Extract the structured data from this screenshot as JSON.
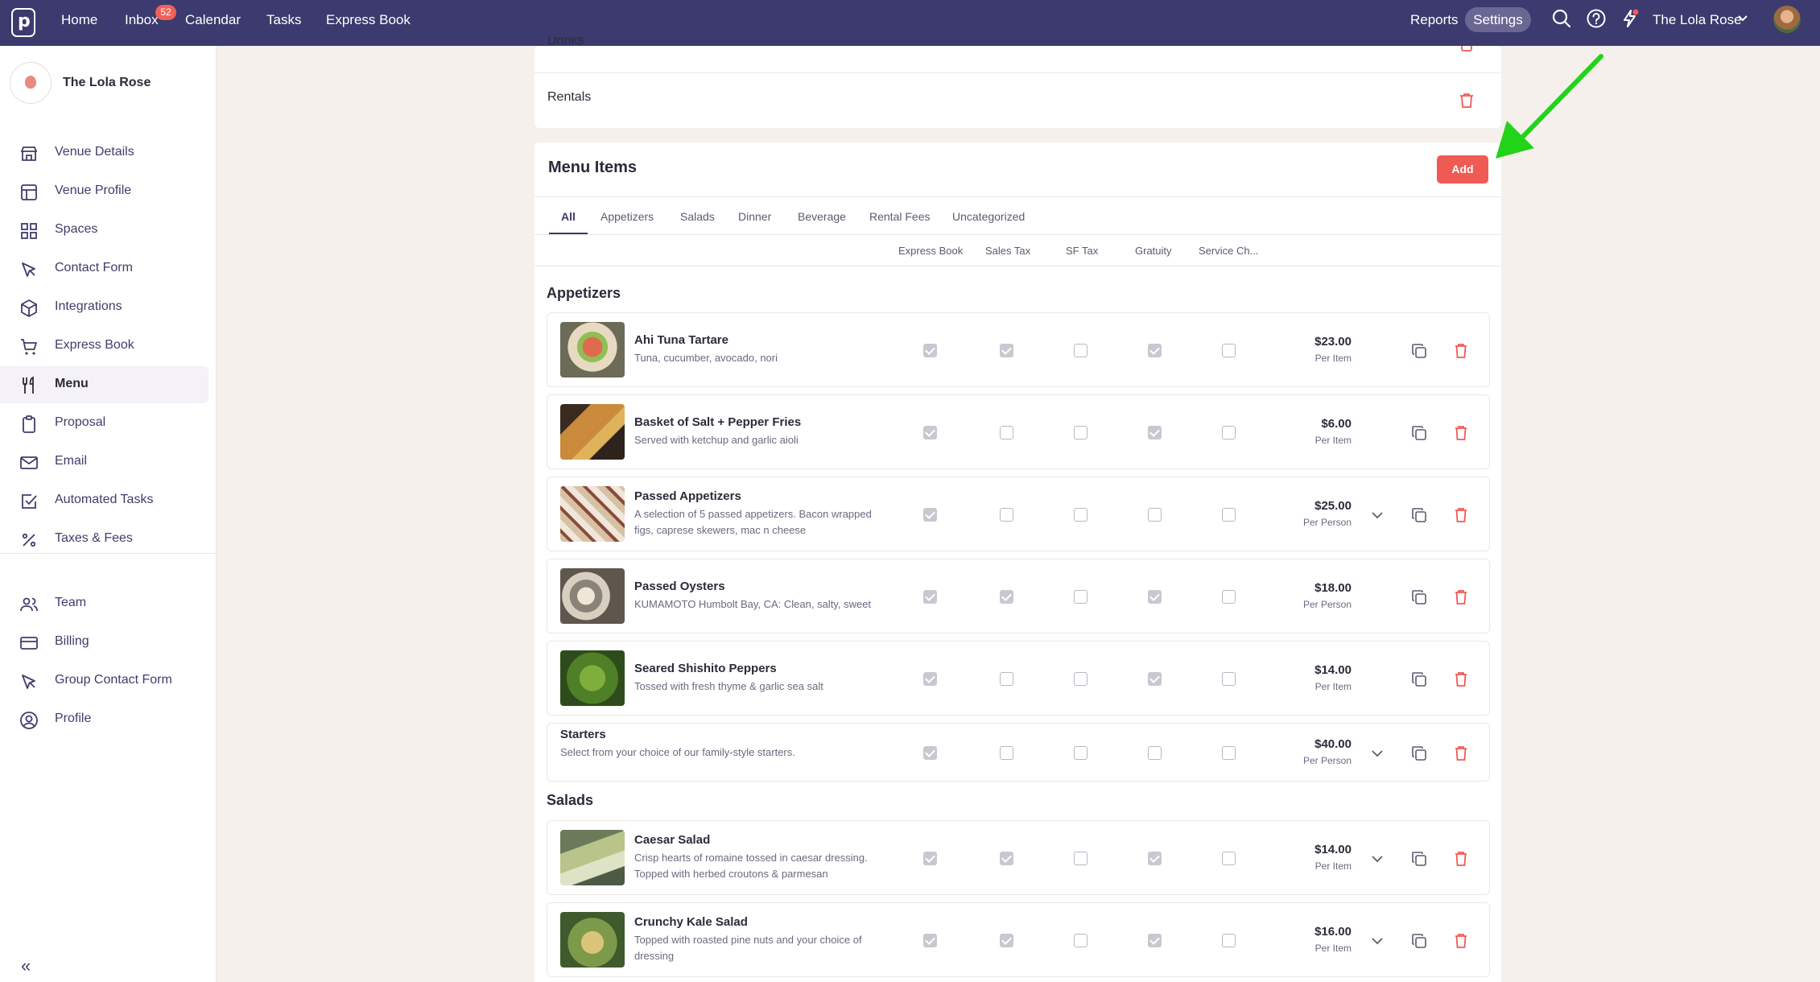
{
  "topbar": {
    "logo_letter": "p",
    "nav": [
      {
        "label": "Home"
      },
      {
        "label": "Inbox"
      },
      {
        "label": "Calendar"
      },
      {
        "label": "Tasks"
      },
      {
        "label": "Express Book"
      }
    ],
    "inbox_count": "52",
    "reports_label": "Reports",
    "settings_label": "Settings",
    "account_name": "The Lola Rose"
  },
  "sidebar": {
    "venue_name": "The Lola Rose",
    "items": [
      {
        "label": "Venue Details",
        "icon": "storefront-icon"
      },
      {
        "label": "Venue Profile",
        "icon": "layout-icon"
      },
      {
        "label": "Spaces",
        "icon": "grid-icon"
      },
      {
        "label": "Contact Form",
        "icon": "cursor-icon"
      },
      {
        "label": "Integrations",
        "icon": "cube-icon"
      },
      {
        "label": "Express Book",
        "icon": "cart-icon"
      },
      {
        "label": "Menu",
        "icon": "fork-knife-icon"
      },
      {
        "label": "Proposal",
        "icon": "clipboard-icon"
      },
      {
        "label": "Email",
        "icon": "mail-icon"
      },
      {
        "label": "Automated Tasks",
        "icon": "checkbox-icon"
      },
      {
        "label": "Taxes & Fees",
        "icon": "percent-icon"
      }
    ],
    "bottom_items": [
      {
        "label": "Team",
        "icon": "people-icon"
      },
      {
        "label": "Billing",
        "icon": "card-icon"
      },
      {
        "label": "Group Contact Form",
        "icon": "cursor-icon"
      },
      {
        "label": "Profile",
        "icon": "user-circle-icon"
      }
    ],
    "active": "Menu"
  },
  "categories_list": {
    "partial_row": "Drinks",
    "last_row": "Rentals"
  },
  "menu_items": {
    "title": "Menu Items",
    "add_label": "Add",
    "tabs": [
      "All",
      "Appetizers",
      "Salads",
      "Dinner",
      "Beverage",
      "Rental Fees",
      "Uncategorized"
    ],
    "active_tab": "All",
    "columns": [
      "Express Book",
      "Sales Tax",
      "SF Tax",
      "Gratuity",
      "Service Ch..."
    ],
    "groups": [
      {
        "title": "Appetizers",
        "items": [
          {
            "name": "Ahi Tuna Tartare",
            "desc": "Tuna, cucumber, avocado, nori",
            "checks": [
              true,
              true,
              false,
              true,
              false
            ],
            "price": "$23.00",
            "unit": "Per Item",
            "expandable": false,
            "image": "tuna-tartare"
          },
          {
            "name": "Basket of Salt + Pepper Fries",
            "desc": "Served with ketchup and garlic aioli",
            "checks": [
              true,
              false,
              false,
              true,
              false
            ],
            "price": "$6.00",
            "unit": "Per Item",
            "expandable": false,
            "image": "fries"
          },
          {
            "name": "Passed Appetizers",
            "desc": "A selection of 5 passed appetizers. Bacon wrapped figs, caprese skewers, mac n cheese",
            "checks": [
              true,
              false,
              false,
              false,
              false
            ],
            "price": "$25.00",
            "unit": "Per Person",
            "expandable": true,
            "image": "passed-appetizers"
          },
          {
            "name": "Passed Oysters",
            "desc": "KUMAMOTO Humbolt Bay, CA: Clean, salty, sweet",
            "checks": [
              true,
              true,
              false,
              true,
              false
            ],
            "price": "$18.00",
            "unit": "Per Person",
            "expandable": false,
            "image": "oysters"
          },
          {
            "name": "Seared Shishito Peppers",
            "desc": "Tossed with fresh thyme & garlic sea salt",
            "checks": [
              true,
              false,
              false,
              true,
              false
            ],
            "price": "$14.00",
            "unit": "Per Item",
            "expandable": false,
            "image": "shishito"
          },
          {
            "name": "Starters",
            "desc": "Select from your choice of our family-style starters.",
            "checks": [
              true,
              false,
              false,
              false,
              false
            ],
            "price": "$40.00",
            "unit": "Per Person",
            "expandable": true,
            "image": null
          }
        ]
      },
      {
        "title": "Salads",
        "items": [
          {
            "name": "Caesar Salad",
            "desc": "Crisp hearts of romaine tossed in caesar dressing. Topped with herbed croutons & parmesan",
            "checks": [
              true,
              true,
              false,
              true,
              false
            ],
            "price": "$14.00",
            "unit": "Per Item",
            "expandable": true,
            "image": "caesar"
          },
          {
            "name": "Crunchy Kale Salad",
            "desc": "Topped with roasted pine nuts and your choice of dressing",
            "checks": [
              true,
              true,
              false,
              true,
              false
            ],
            "price": "$16.00",
            "unit": "Per Item",
            "expandable": true,
            "image": "kale"
          }
        ]
      }
    ]
  },
  "colors": {
    "topbar": "#3c3a6e",
    "accent_red": "#f05a55",
    "annotation_arrow": "#22d31a"
  }
}
